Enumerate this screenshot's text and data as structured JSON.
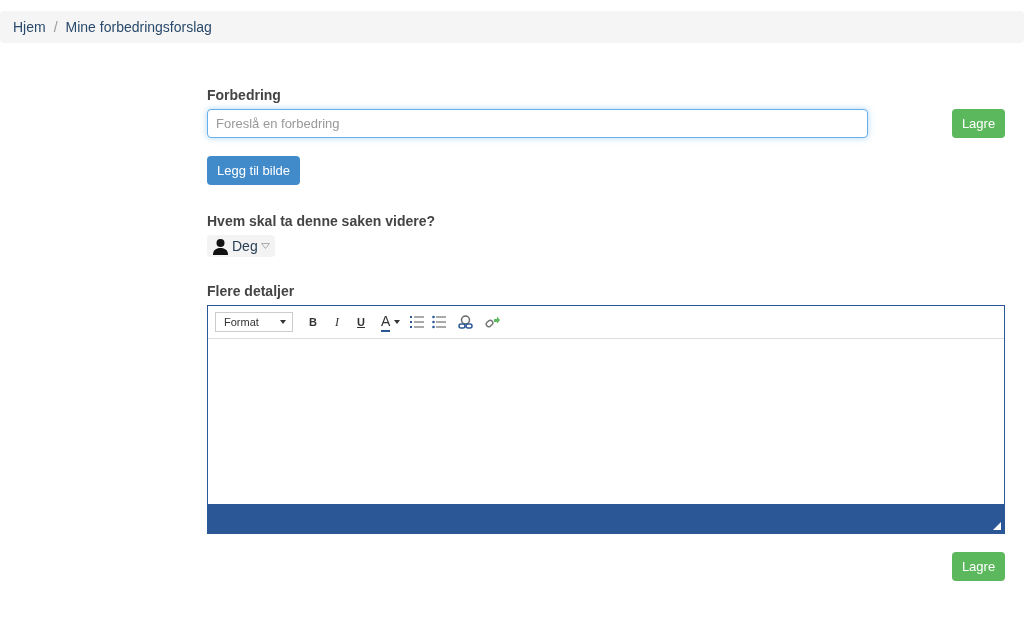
{
  "breadcrumb": [
    {
      "label": "Hjem"
    },
    {
      "label": "Mine forbedringsforslag"
    }
  ],
  "breadcrumb_separator": "/",
  "improvement": {
    "label": "Forbedring",
    "placeholder": "Foreslå en forbedring"
  },
  "save_top": "Lagre",
  "add_image": "Legg til bilde",
  "assignee": {
    "label": "Hvem skal ta denne saken videre?",
    "value": "Deg"
  },
  "details": {
    "label": "Flere detaljer",
    "format": "Format",
    "bold": "B",
    "italic": "I",
    "underline": "U",
    "text_color": "A"
  },
  "save_bottom": "Lagre"
}
